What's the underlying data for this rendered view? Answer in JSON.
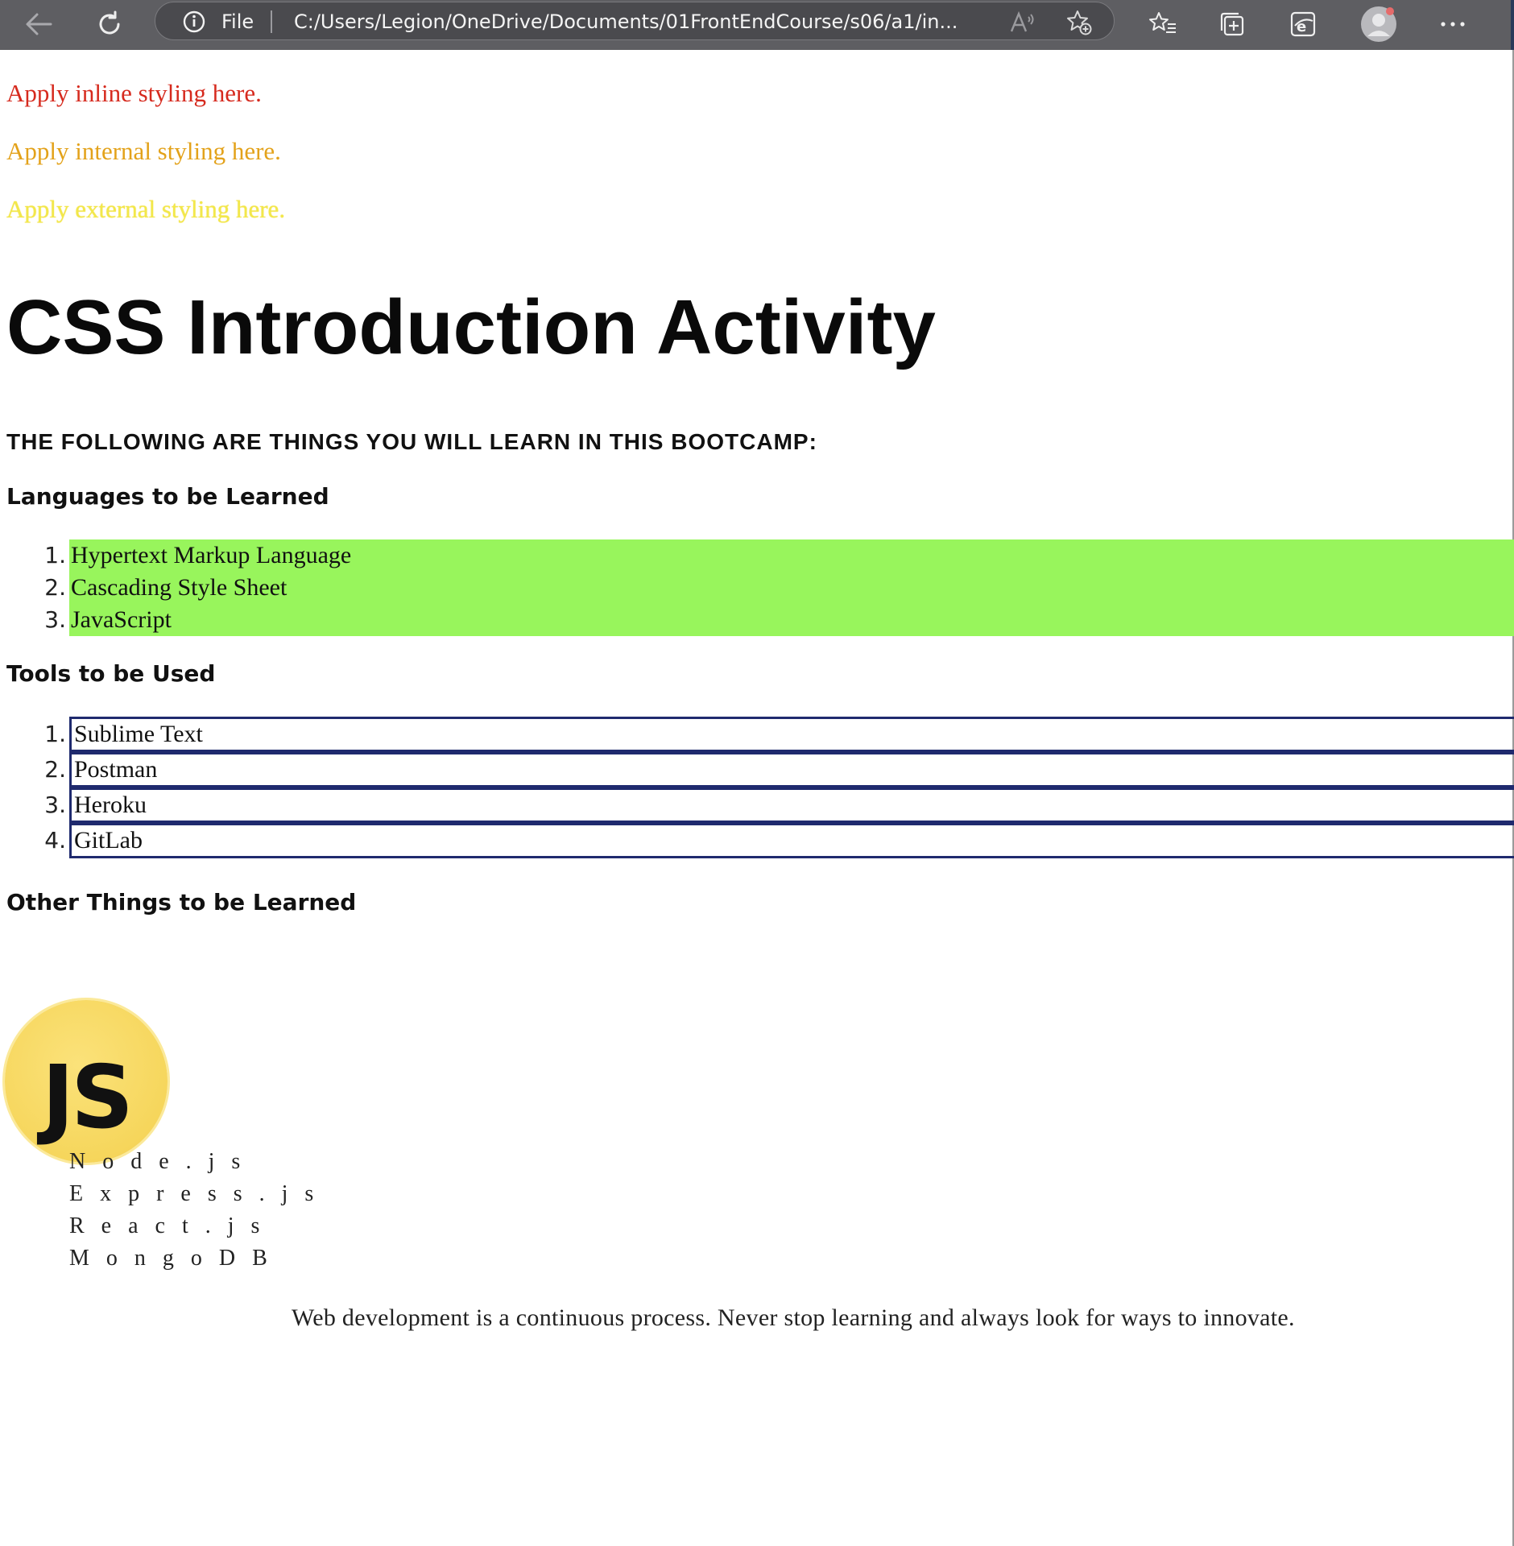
{
  "browser": {
    "scheme_label": "File",
    "url": "C:/Users/Legion/OneDrive/Documents/01FrontEndCourse/s06/a1/in..."
  },
  "page": {
    "inline_text": "Apply inline styling here.",
    "internal_text": "Apply internal styling here.",
    "external_text": "Apply external styling here.",
    "title": "CSS Introduction Activity",
    "subtitle": "THE FOLLOWING ARE THINGS YOU WILL LEARN IN THIS BOOTCAMP:",
    "languages": {
      "heading": "Languages to be Learned",
      "items": [
        {
          "num": "1.",
          "label": "Hypertext Markup Language"
        },
        {
          "num": "2.",
          "label": "Cascading Style Sheet"
        },
        {
          "num": "3.",
          "label": "JavaScript"
        }
      ]
    },
    "tools": {
      "heading": "Tools to be Used",
      "items": [
        {
          "num": "1.",
          "label": "Sublime Text"
        },
        {
          "num": "2.",
          "label": "Postman"
        },
        {
          "num": "3.",
          "label": "Heroku"
        },
        {
          "num": "4.",
          "label": "GitLab"
        }
      ]
    },
    "other": {
      "heading": "Other Things to be Learned",
      "logo_text": "JS",
      "items": [
        "Node.js",
        "Express.js",
        "React.js",
        "MongoDB"
      ]
    },
    "footer_quote": "Web development is a continuous process. Never stop learning and always look for ways to innovate."
  },
  "colors": {
    "chrome_bg": "#5e5e62",
    "inline_text": "#d62a1e",
    "internal_text": "#e3a21a",
    "external_text": "#f2e84a",
    "languages_bg": "#98f55c",
    "tools_border": "#1f2a6e",
    "js_logo_bg": "#f6d65c"
  },
  "icons": {
    "back": "arrow-left-icon",
    "refresh": "refresh-icon",
    "info": "info-icon",
    "read_aloud": "read-aloud-icon",
    "add_favorite": "add-favorite-icon",
    "favorites": "favorites-icon",
    "collections": "collections-icon",
    "ie_mode": "ie-mode-icon",
    "profile": "profile-avatar-icon",
    "more": "more-options-icon"
  }
}
